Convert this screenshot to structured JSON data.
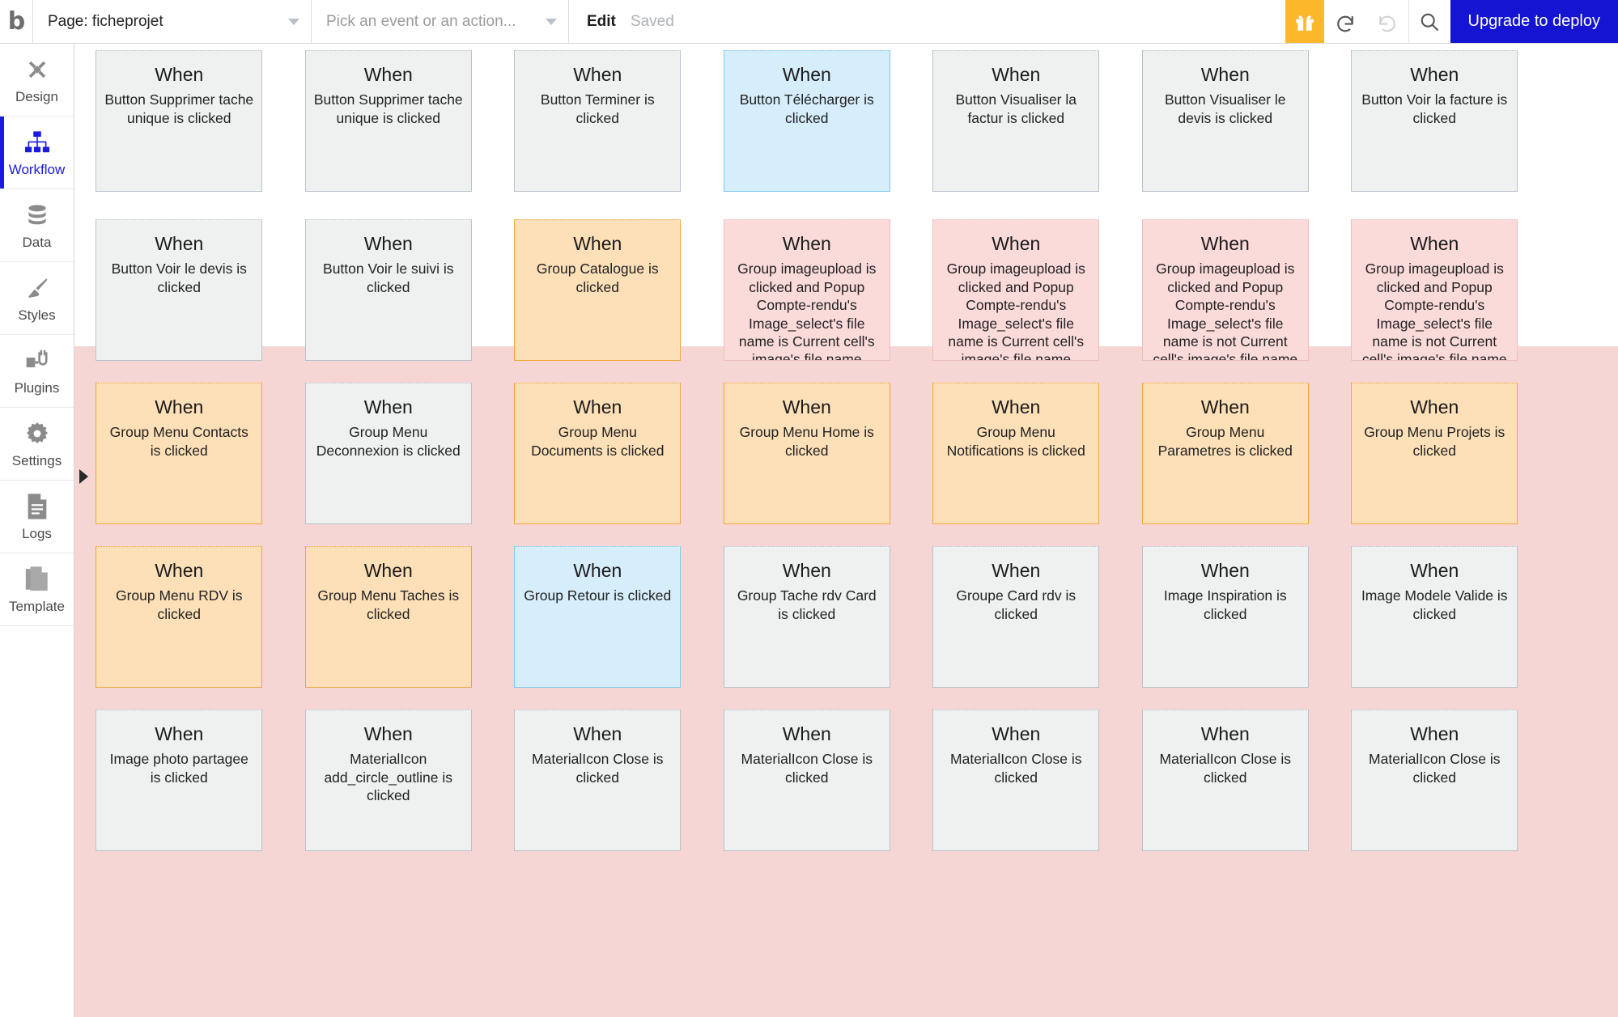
{
  "topbar": {
    "logo": "bubble-logo-icon",
    "page_select": {
      "value": "Page: ficheprojet"
    },
    "event_select": {
      "placeholder": "Pick an event or an action..."
    },
    "edit_label": "Edit",
    "saved_label": "Saved",
    "gift_icon": "gift-icon",
    "undo_icon": "undo-icon",
    "redo_icon": "redo-icon",
    "search_icon": "search-icon",
    "upgrade_label": "Upgrade to deploy",
    "accent_blue": "#1414d2",
    "accent_orange": "#fdb72b"
  },
  "sidebar": {
    "items": [
      {
        "label": "Design",
        "icon": "design-icon",
        "active": false
      },
      {
        "label": "Workflow",
        "icon": "workflow-icon",
        "active": true
      },
      {
        "label": "Data",
        "icon": "database-icon",
        "active": false
      },
      {
        "label": "Styles",
        "icon": "paintbrush-icon",
        "active": false
      },
      {
        "label": "Plugins",
        "icon": "plugins-icon",
        "active": false
      },
      {
        "label": "Settings",
        "icon": "gear-icon",
        "active": false
      },
      {
        "label": "Logs",
        "icon": "logs-document-icon",
        "active": false
      },
      {
        "label": "Template",
        "icon": "template-pages-icon",
        "active": false
      }
    ],
    "expand_icon": "expand-arrow-icon"
  },
  "canvas": {
    "when_label": "When",
    "selection_color": "#f6d5d5",
    "rows": [
      [
        {
          "desc": "Button Supprimer tache unique is clicked",
          "color": "gray"
        },
        {
          "desc": "Button Supprimer tache unique is clicked",
          "color": "gray"
        },
        {
          "desc": "Button Terminer is clicked",
          "color": "gray"
        },
        {
          "desc": "Button Télécharger is clicked",
          "color": "blue"
        },
        {
          "desc": "Button Visualiser la factur is clicked",
          "color": "gray"
        },
        {
          "desc": "Button Visualiser le devis is clicked",
          "color": "gray"
        },
        {
          "desc": "Button Voir la facture is clicked",
          "color": "gray"
        }
      ],
      [
        {
          "desc": "Button Voir le devis is clicked",
          "color": "gray"
        },
        {
          "desc": "Button Voir le suivi is clicked",
          "color": "gray"
        },
        {
          "desc": "Group Catalogue is clicked",
          "color": "orange"
        },
        {
          "desc": "Group imageupload is clicked and Popup Compte-rendu's Image_select's file name is Current cell's image's file name",
          "color": "pink"
        },
        {
          "desc": "Group imageupload is clicked and Popup Compte-rendu's Image_select's file name is Current cell's image's file name",
          "color": "pink"
        },
        {
          "desc": "Group imageupload is clicked and Popup Compte-rendu's Image_select's file name is not Current cell's image's file name",
          "color": "pink"
        },
        {
          "desc": "Group imageupload is clicked and Popup Compte-rendu's Image_select's file name is not Current cell's image's file name",
          "color": "pink"
        }
      ],
      [
        {
          "desc": "Group Menu Contacts is clicked",
          "color": "orange"
        },
        {
          "desc": "Group Menu Deconnexion is clicked",
          "color": "gray"
        },
        {
          "desc": "Group Menu Documents is clicked",
          "color": "orange"
        },
        {
          "desc": "Group Menu Home is clicked",
          "color": "orange"
        },
        {
          "desc": "Group Menu Notifications is clicked",
          "color": "orange"
        },
        {
          "desc": "Group Menu Parametres is clicked",
          "color": "orange"
        },
        {
          "desc": "Group Menu Projets is clicked",
          "color": "orange"
        }
      ],
      [
        {
          "desc": "Group Menu RDV is clicked",
          "color": "orange"
        },
        {
          "desc": "Group Menu Taches is clicked",
          "color": "orange"
        },
        {
          "desc": "Group Retour is clicked",
          "color": "blue"
        },
        {
          "desc": "Group Tache rdv Card is clicked",
          "color": "gray"
        },
        {
          "desc": "Groupe Card rdv is clicked",
          "color": "gray"
        },
        {
          "desc": "Image Inspiration is clicked",
          "color": "gray"
        },
        {
          "desc": "Image Modele Valide is clicked",
          "color": "gray"
        }
      ],
      [
        {
          "desc": "Image photo partagee is clicked",
          "color": "gray"
        },
        {
          "desc": "MaterialIcon add_circle_outline is clicked",
          "color": "gray"
        },
        {
          "desc": "MaterialIcon Close is clicked",
          "color": "gray"
        },
        {
          "desc": "MaterialIcon Close is clicked",
          "color": "gray"
        },
        {
          "desc": "MaterialIcon Close is clicked",
          "color": "gray"
        },
        {
          "desc": "MaterialIcon Close is clicked",
          "color": "gray"
        },
        {
          "desc": "MaterialIcon Close is clicked",
          "color": "gray"
        }
      ]
    ]
  }
}
